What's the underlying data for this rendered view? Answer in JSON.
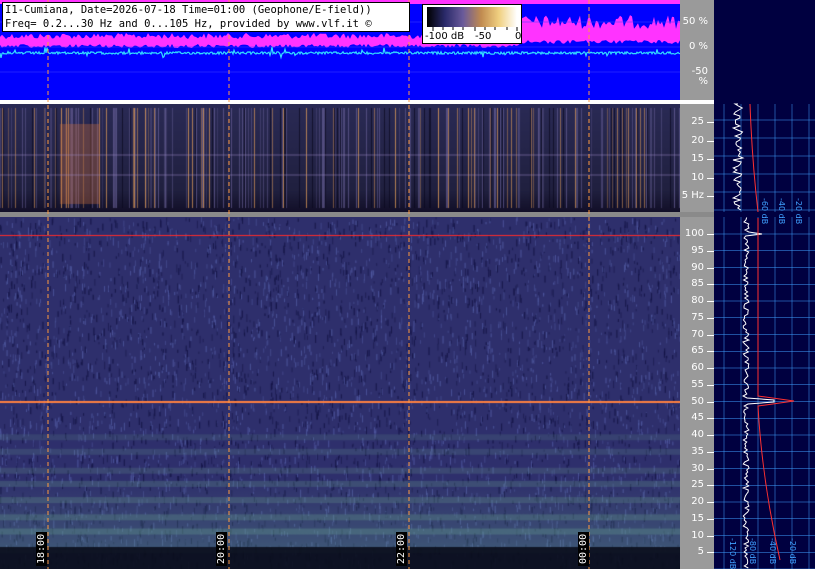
{
  "header": {
    "line1": "I1-Cumiana, Date=2026-07-18 Time=01:00 (Geophone/E-field))",
    "line2": "Freq= 0.2...30 Hz and 0...105 Hz, provided by www.vlf.it ©"
  },
  "scale": {
    "labels": [
      "-100 dB",
      "-50",
      "0"
    ],
    "colors": [
      "#000000",
      "#2a2a6a",
      "#6a5a9a",
      "#c08a50",
      "#f0d080",
      "#ffffff"
    ]
  },
  "amplitude_panel": {
    "percent_ticks": [
      "50 %",
      "0 %",
      "-50 %"
    ],
    "colors": {
      "background": "#0000ff",
      "envelope": "#ff33ff",
      "trace": "#33ddff"
    }
  },
  "low_freq_panel": {
    "ticks": [
      "25",
      "20",
      "15",
      "10",
      "5 Hz"
    ]
  },
  "high_freq_panel": {
    "ticks": [
      "100",
      "95",
      "90",
      "85",
      "80",
      "75",
      "70",
      "65",
      "60",
      "55",
      "50",
      "45",
      "40",
      "35",
      "30",
      "25",
      "20",
      "15",
      "10",
      "5"
    ]
  },
  "time_markers": [
    "18:00",
    "20:00",
    "22:00",
    "00:00"
  ],
  "spectrum_labels": {
    "upper": [
      "-60 dB",
      "-40 dB",
      "-20 dB"
    ],
    "lower": [
      "-120 dB",
      "-80 dB",
      "-40 dB",
      "-20 dB"
    ]
  },
  "colors": {
    "spectrogram_base": "#303070",
    "hz_line": "#ff2020",
    "grid": "#3fa0ff",
    "marker": "#ff9a40",
    "side_panel": "#000040"
  }
}
